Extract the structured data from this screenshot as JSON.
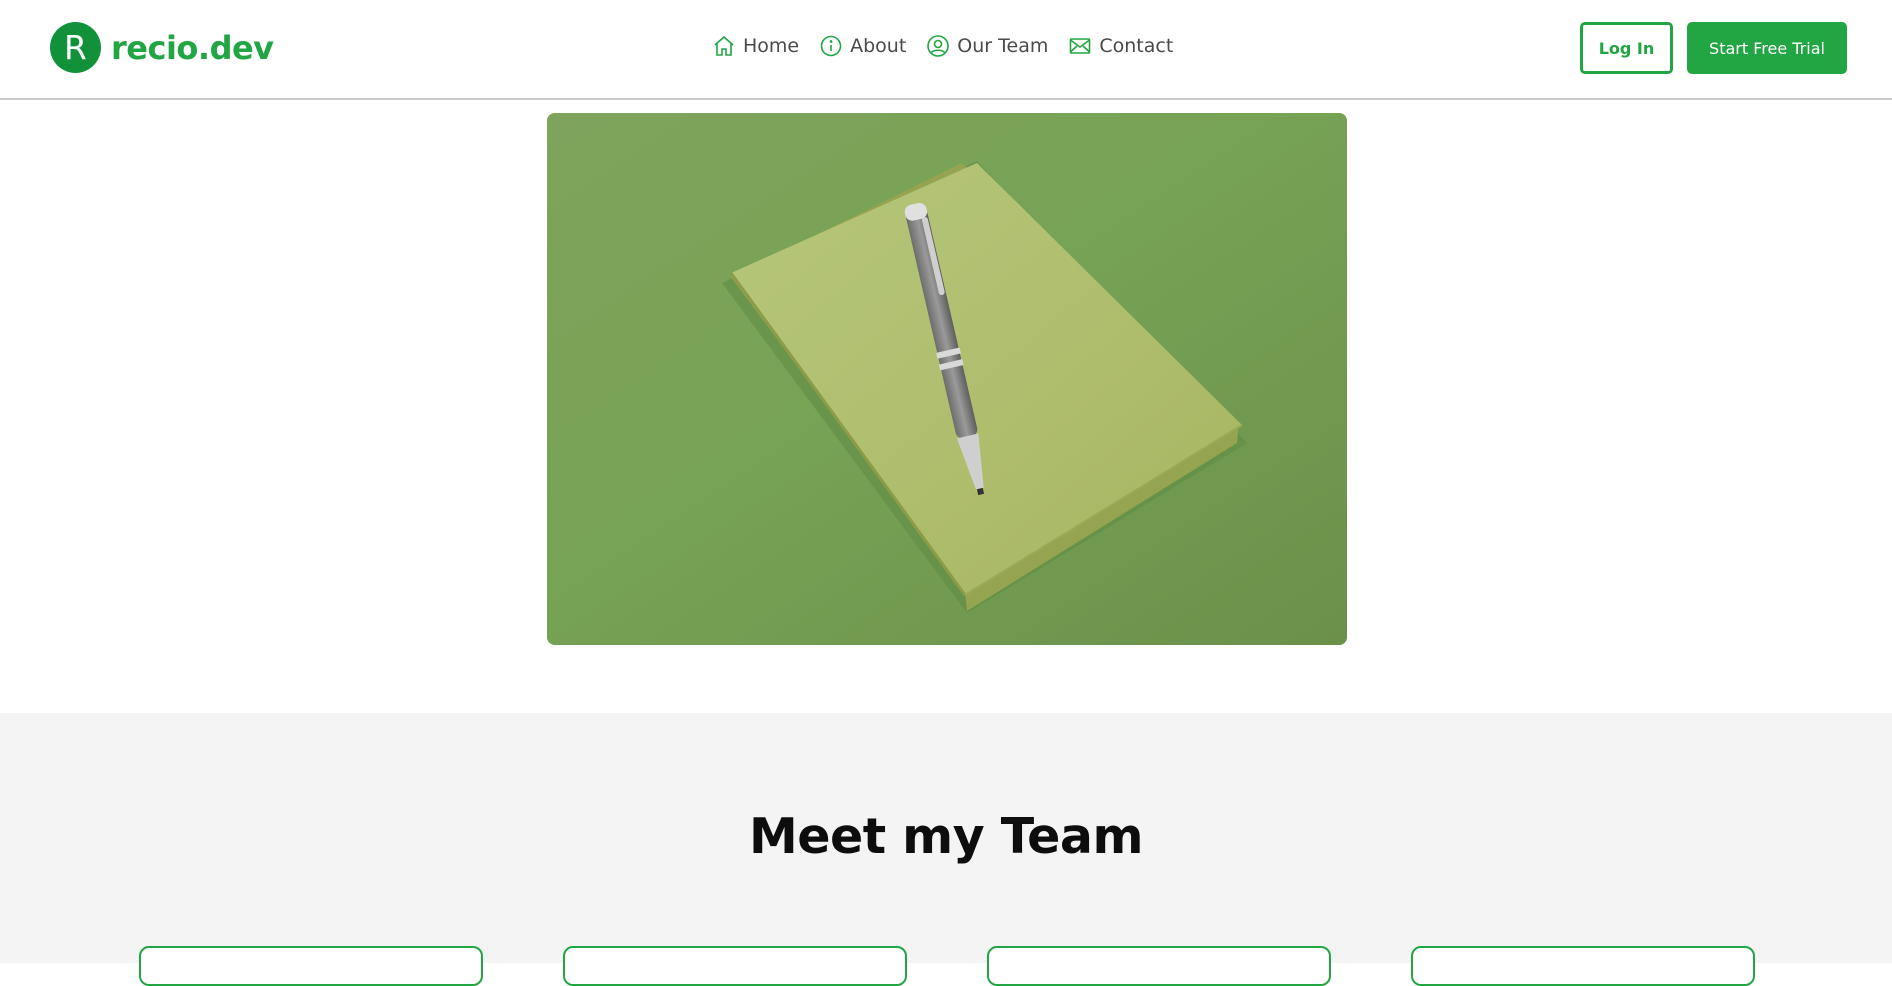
{
  "brand": {
    "logo_letter": "R",
    "name": "recio.dev",
    "color": "#22a543",
    "mark_color": "#10913a"
  },
  "nav": {
    "items": [
      {
        "label": "Home",
        "icon": "home-icon"
      },
      {
        "label": "About",
        "icon": "info-icon"
      },
      {
        "label": "Our Team",
        "icon": "user-circle-icon"
      },
      {
        "label": "Contact",
        "icon": "mail-icon"
      }
    ]
  },
  "actions": {
    "login_label": "Log In",
    "trial_label": "Start Free Trial"
  },
  "hero": {
    "image_subject": "green-notebook-with-pen",
    "background_color": "#75a054"
  },
  "team": {
    "title": "Meet my Team",
    "section_background": "#f4f4f4",
    "card_border_color": "#22a543"
  }
}
